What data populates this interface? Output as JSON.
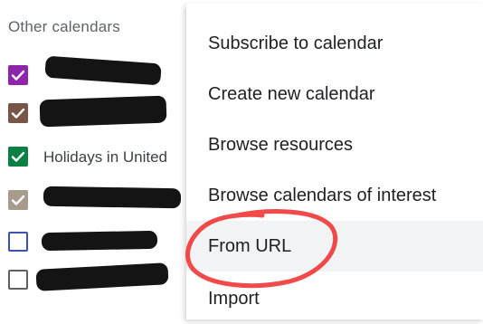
{
  "sidebar": {
    "title": "Other calendars",
    "items": [
      {
        "label": "",
        "color": "#8e24aa",
        "checked": true
      },
      {
        "label": "",
        "color": "#795548",
        "checked": true
      },
      {
        "label": "Holidays in United",
        "color": "#0b8043",
        "checked": true
      },
      {
        "label": "",
        "color": "#a79b8e",
        "checked": true
      },
      {
        "label": "",
        "color": "#3f51b5",
        "checked": false
      },
      {
        "label": "",
        "color": "#616161",
        "checked": false
      }
    ]
  },
  "menu": {
    "items": [
      {
        "label": "Subscribe to calendar"
      },
      {
        "label": "Create new calendar"
      },
      {
        "label": "Browse resources"
      },
      {
        "label": "Browse calendars of interest"
      },
      {
        "label": "From URL",
        "highlighted": true
      },
      {
        "label": "Import"
      }
    ]
  },
  "annotation": {
    "color": "#ef3b3b",
    "target": "From URL"
  }
}
